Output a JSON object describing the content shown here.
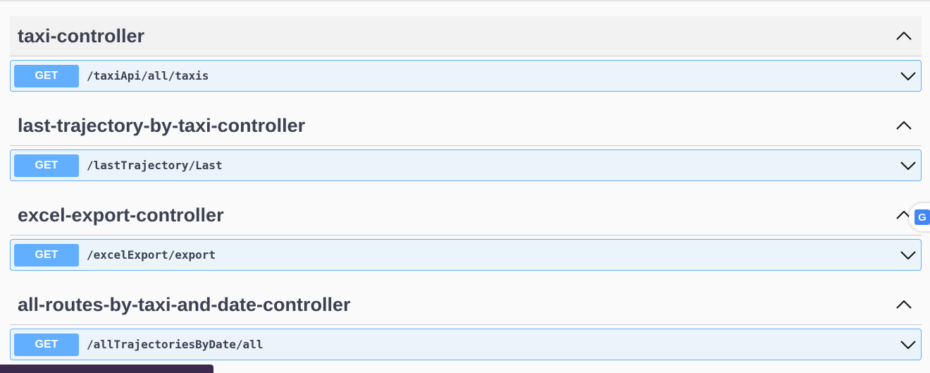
{
  "sections": [
    {
      "title": "taxi-controller",
      "method": "GET",
      "path": "/taxiApi/all/taxis"
    },
    {
      "title": "last-trajectory-by-taxi-controller",
      "method": "GET",
      "path": "/lastTrajectory/Last"
    },
    {
      "title": "excel-export-controller",
      "method": "GET",
      "path": "/excelExport/export"
    },
    {
      "title": "all-routes-by-taxi-and-date-controller",
      "method": "GET",
      "path": "/allTrajectoriesByDate/all"
    }
  ],
  "colors": {
    "get_accent": "#61affe",
    "get_background": "#ebf3fb",
    "title_text": "#3b4151"
  },
  "icons": {
    "section_toggle": "chevron-up-icon",
    "operation_toggle": "chevron-down-icon",
    "translate": "google-translate-icon"
  }
}
